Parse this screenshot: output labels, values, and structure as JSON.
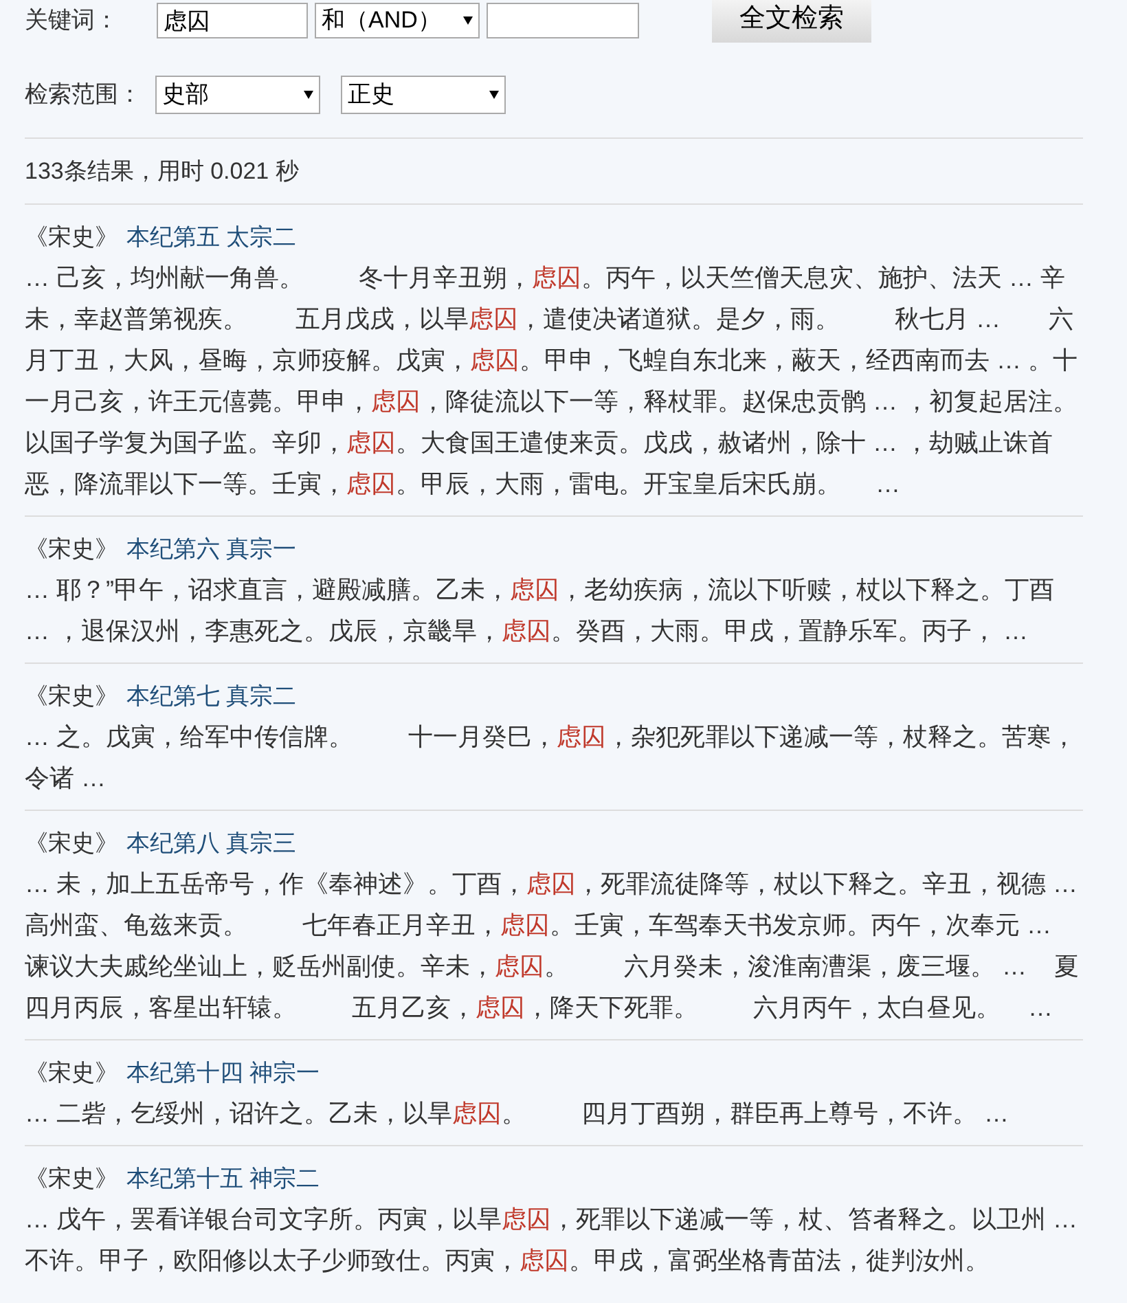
{
  "search_form": {
    "keyword_label": "关键词：",
    "keyword_value": "虑囚",
    "operator": "和（AND）",
    "search_button": "全文检索",
    "scope_label": "检索范围：",
    "scope_category": "史部",
    "scope_subcategory": "正史"
  },
  "summary": "133条结果，用时 0.021 秒",
  "results": [
    {
      "book": "《宋史》",
      "chapter": "本纪第五 太宗二",
      "snippet": [
        {
          "text": "… 己亥，均州献一角兽。        冬十月辛丑朔，",
          "hit": false
        },
        {
          "text": "虑囚",
          "hit": true
        },
        {
          "text": "。丙午，以天竺僧天息灾、施护、法天 … 辛未，幸赵普第视疾。       五月戊戌，以旱",
          "hit": false
        },
        {
          "text": "虑囚",
          "hit": true
        },
        {
          "text": "，遣使决诸道狱。是夕，雨。        秋七月 …       六月丁丑，大风，昼晦，京师疫解。戊寅，",
          "hit": false
        },
        {
          "text": "虑囚",
          "hit": true
        },
        {
          "text": "。甲申，飞蝗自东北来，蔽天，经西南而去 … 。十一月己亥，许王元僖薨。甲申，",
          "hit": false
        },
        {
          "text": "虑囚",
          "hit": true
        },
        {
          "text": "，降徒流以下一等，释杖罪。赵保忠贡鹘 … ，初复起居注。以国子学复为国子监。辛卯，",
          "hit": false
        },
        {
          "text": "虑囚",
          "hit": true
        },
        {
          "text": "。大食国王遣使来贡。戊戌，赦诸州，除十 … ，劫贼止诛首恶，降流罪以下一等。壬寅，",
          "hit": false
        },
        {
          "text": "虑囚",
          "hit": true
        },
        {
          "text": "。甲辰，大雨，雷电。开宝皇后宋氏崩。     …",
          "hit": false
        }
      ]
    },
    {
      "book": "《宋史》",
      "chapter": "本纪第六 真宗一",
      "snippet": [
        {
          "text": "… 耶？”甲午，诏求直言，避殿减膳。乙未，",
          "hit": false
        },
        {
          "text": "虑囚",
          "hit": true
        },
        {
          "text": "，老幼疾病，流以下听赎，杖以下释之。丁酉 … ，退保汉州，李惠死之。戊辰，京畿旱，",
          "hit": false
        },
        {
          "text": "虑囚",
          "hit": true
        },
        {
          "text": "。癸酉，大雨。甲戌，置静乐军。丙子， …",
          "hit": false
        }
      ]
    },
    {
      "book": "《宋史》",
      "chapter": "本纪第七 真宗二",
      "snippet": [
        {
          "text": "… 之。戊寅，给军中传信牌。        十一月癸巳，",
          "hit": false
        },
        {
          "text": "虑囚",
          "hit": true
        },
        {
          "text": "，杂犯死罪以下递减一等，杖释之。苦寒，令诸 …",
          "hit": false
        }
      ]
    },
    {
      "book": "《宋史》",
      "chapter": "本纪第八 真宗三",
      "snippet": [
        {
          "text": "… 未，加上五岳帝号，作《奉神述》。丁酉，",
          "hit": false
        },
        {
          "text": "虑囚",
          "hit": true
        },
        {
          "text": "，死罪流徒降等，杖以下释之。辛丑，视德 … 高州蛮、龟兹来贡。        七年春正月辛丑，",
          "hit": false
        },
        {
          "text": "虑囚",
          "hit": true
        },
        {
          "text": "。壬寅，车驾奉天书发京师。丙午，次奉元 … 谏议大夫戚纶坐讪上，贬岳州副使。辛未，",
          "hit": false
        },
        {
          "text": "虑囚",
          "hit": true
        },
        {
          "text": "。        六月癸未，浚淮南漕渠，废三堰。 …    夏四月丙辰，客星出轩辕。        五月乙亥，",
          "hit": false
        },
        {
          "text": "虑囚",
          "hit": true
        },
        {
          "text": "，降天下死罪。        六月丙午，太白昼见。    …",
          "hit": false
        }
      ]
    },
    {
      "book": "《宋史》",
      "chapter": "本纪第十四 神宗一",
      "snippet": [
        {
          "text": "… 二砦，乞绥州，诏许之。乙未，以旱",
          "hit": false
        },
        {
          "text": "虑囚",
          "hit": true
        },
        {
          "text": "。        四月丁酉朔，群臣再上尊号，不许。 …",
          "hit": false
        }
      ]
    },
    {
      "book": "《宋史》",
      "chapter": "本纪第十五 神宗二",
      "snippet": [
        {
          "text": "… 戊午，罢看详银台司文字所。丙寅，以旱",
          "hit": false
        },
        {
          "text": "虑囚",
          "hit": true
        },
        {
          "text": "，死罪以下递减一等，杖、笞者释之。以卫州 … 不许。甲子，欧阳修以太子少师致仕。丙寅，",
          "hit": false
        },
        {
          "text": "虑囚",
          "hit": true
        },
        {
          "text": "。甲戌，富弼坐格青苗法，徙判汝州。",
          "hit": false
        }
      ]
    }
  ]
}
